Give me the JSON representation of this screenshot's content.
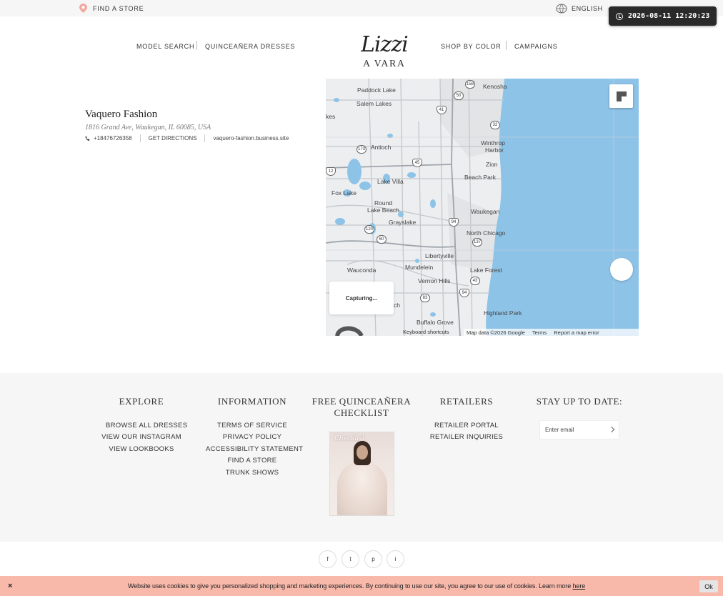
{
  "topbar": {
    "find_store": "FIND A STORE",
    "language": "ENGLISH",
    "clock": "2026-08-11 12:20:23"
  },
  "nav": {
    "model_search": "MODEL SEARCH",
    "quince_dresses": "QUINCEAÑERA DRESSES",
    "shop_by_color": "SHOP BY COLOR",
    "campaigns": "CAMPAIGNS",
    "logo_script": "Lizzi",
    "logo_sub": "A VARA"
  },
  "store": {
    "name": "Vaquero Fashion",
    "address": "1816 Grand Ave, Waukegan, IL 60085, USA",
    "phone": "+18476726358",
    "directions": "GET DIRECTIONS",
    "website": "vaquero-fashion.business.site"
  },
  "map": {
    "capturing": "Capturing...",
    "keyboard": "Keyboard shortcuts",
    "data": "Map data ©2026 Google",
    "terms": "Terms",
    "report": "Report a map error",
    "places": [
      {
        "name": "Kenosha"
      },
      {
        "name": "Paddock Lake"
      },
      {
        "name": "Salem Lakes"
      },
      {
        "name": "kes"
      },
      {
        "name": "Antioch"
      },
      {
        "name": "Winthrop"
      },
      {
        "name": "Harbor"
      },
      {
        "name": "Zion"
      },
      {
        "name": "Beach Park"
      },
      {
        "name": "Lake Villa"
      },
      {
        "name": "Fox Lake"
      },
      {
        "name": "Round"
      },
      {
        "name": "Lake Beach"
      },
      {
        "name": "Waukegan"
      },
      {
        "name": "Grayslake"
      },
      {
        "name": "North Chicago"
      },
      {
        "name": "Libertyville"
      },
      {
        "name": "Wauconda"
      },
      {
        "name": "Mundelein"
      },
      {
        "name": "Lake Forest"
      },
      {
        "name": "Vernon Hills"
      },
      {
        "name": "ch"
      },
      {
        "name": "Highland Park"
      },
      {
        "name": "Buffalo Grove"
      }
    ],
    "shields": [
      "158",
      "50",
      "41",
      "32",
      "173",
      "45",
      "12",
      "94",
      "120",
      "60",
      "137",
      "43",
      "83",
      "94"
    ]
  },
  "footer": {
    "explore": {
      "title": "EXPLORE",
      "links": [
        "BROWSE ALL DRESSES",
        "VIEW OUR INSTAGRAM",
        "VIEW LOOKBOOKS"
      ]
    },
    "information": {
      "title": "INFORMATION",
      "links": [
        "TERMS OF SERVICE",
        "PRIVACY POLICY",
        "ACCESSIBILITY STATEMENT",
        "FIND A STORE",
        "TRUNK SHOWS"
      ]
    },
    "checklist": {
      "title_line1": "FREE QUINCEAÑERA",
      "title_line2": "CHECKLIST",
      "image_script": "Checklist"
    },
    "retailers": {
      "title": "RETAILERS",
      "links": [
        "RETAILER PORTAL",
        "RETAILER INQUIRIES"
      ]
    },
    "newsletter": {
      "title": "STAY UP TO DATE:",
      "placeholder": "Enter email"
    },
    "social": [
      "f",
      "t",
      "p",
      "i"
    ]
  },
  "cookie": {
    "close": "×",
    "text": "Website uses cookies to give you personalized shopping and marketing experiences. By continuing to use our site, you agree to our use of cookies. Learn more ",
    "link": "here",
    "ok": "Ok"
  },
  "colors": {
    "map_water": "#8ec3e8",
    "cookie_bg": "#f8b9ab",
    "footer_bg": "#f6f6f6",
    "pin": "#f2a9a0"
  }
}
